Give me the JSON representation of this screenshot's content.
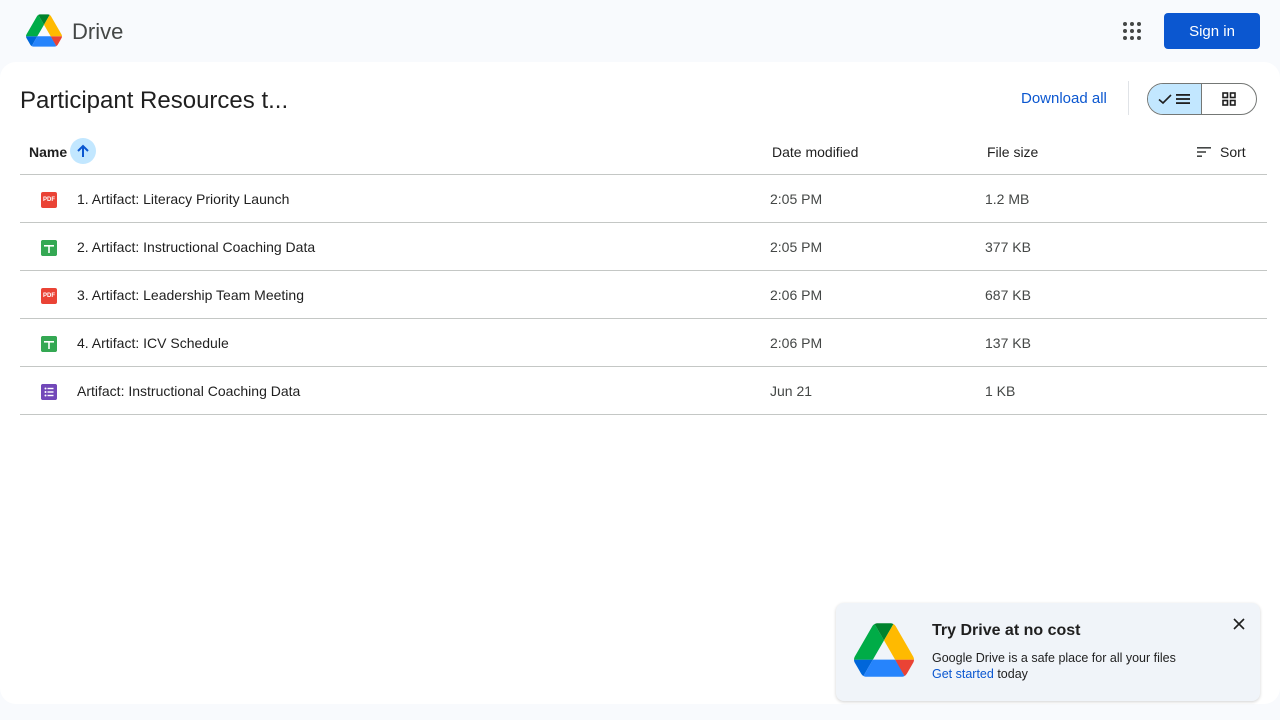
{
  "header": {
    "brand": "Drive",
    "sign_in_label": "Sign in",
    "apps_icon": "apps-grid-icon"
  },
  "toolbar": {
    "folder_title": "Participant Resources t...",
    "download_all_label": "Download all",
    "view_list_icon": "list-view-icon",
    "view_grid_icon": "grid-view-icon",
    "active_view": "list"
  },
  "table": {
    "columns": {
      "name": "Name",
      "date_modified": "Date modified",
      "file_size": "File size",
      "sort": "Sort"
    },
    "sort_direction": "ascending",
    "rows": [
      {
        "type": "pdf",
        "icon": "pdf-icon",
        "icon_text": "PDF",
        "name": "1. Artifact: Literacy Priority Launch",
        "date": "2:05 PM",
        "size": "1.2 MB"
      },
      {
        "type": "sheet",
        "icon": "sheets-icon",
        "icon_text": "",
        "name": "2. Artifact: Instructional Coaching Data",
        "date": "2:05 PM",
        "size": "377 KB"
      },
      {
        "type": "pdf",
        "icon": "pdf-icon",
        "icon_text": "PDF",
        "name": "3. Artifact: Leadership Team Meeting",
        "date": "2:06 PM",
        "size": "687 KB"
      },
      {
        "type": "sheet",
        "icon": "sheets-icon",
        "icon_text": "",
        "name": "4. Artifact: ICV Schedule",
        "date": "2:06 PM",
        "size": "137 KB"
      },
      {
        "type": "form",
        "icon": "forms-icon",
        "icon_text": "",
        "name": "Artifact: Instructional Coaching Data",
        "date": "Jun 21",
        "size": "1 KB"
      }
    ]
  },
  "promo": {
    "title": "Try Drive at no cost",
    "body": "Google Drive is a safe place for all your files",
    "link": "Get started",
    "link_suffix": " today"
  },
  "colors": {
    "accent": "#0b57d0",
    "selected": "#c2e7ff",
    "pdf": "#ea4335",
    "sheets": "#34a853",
    "forms": "#7248b9"
  }
}
